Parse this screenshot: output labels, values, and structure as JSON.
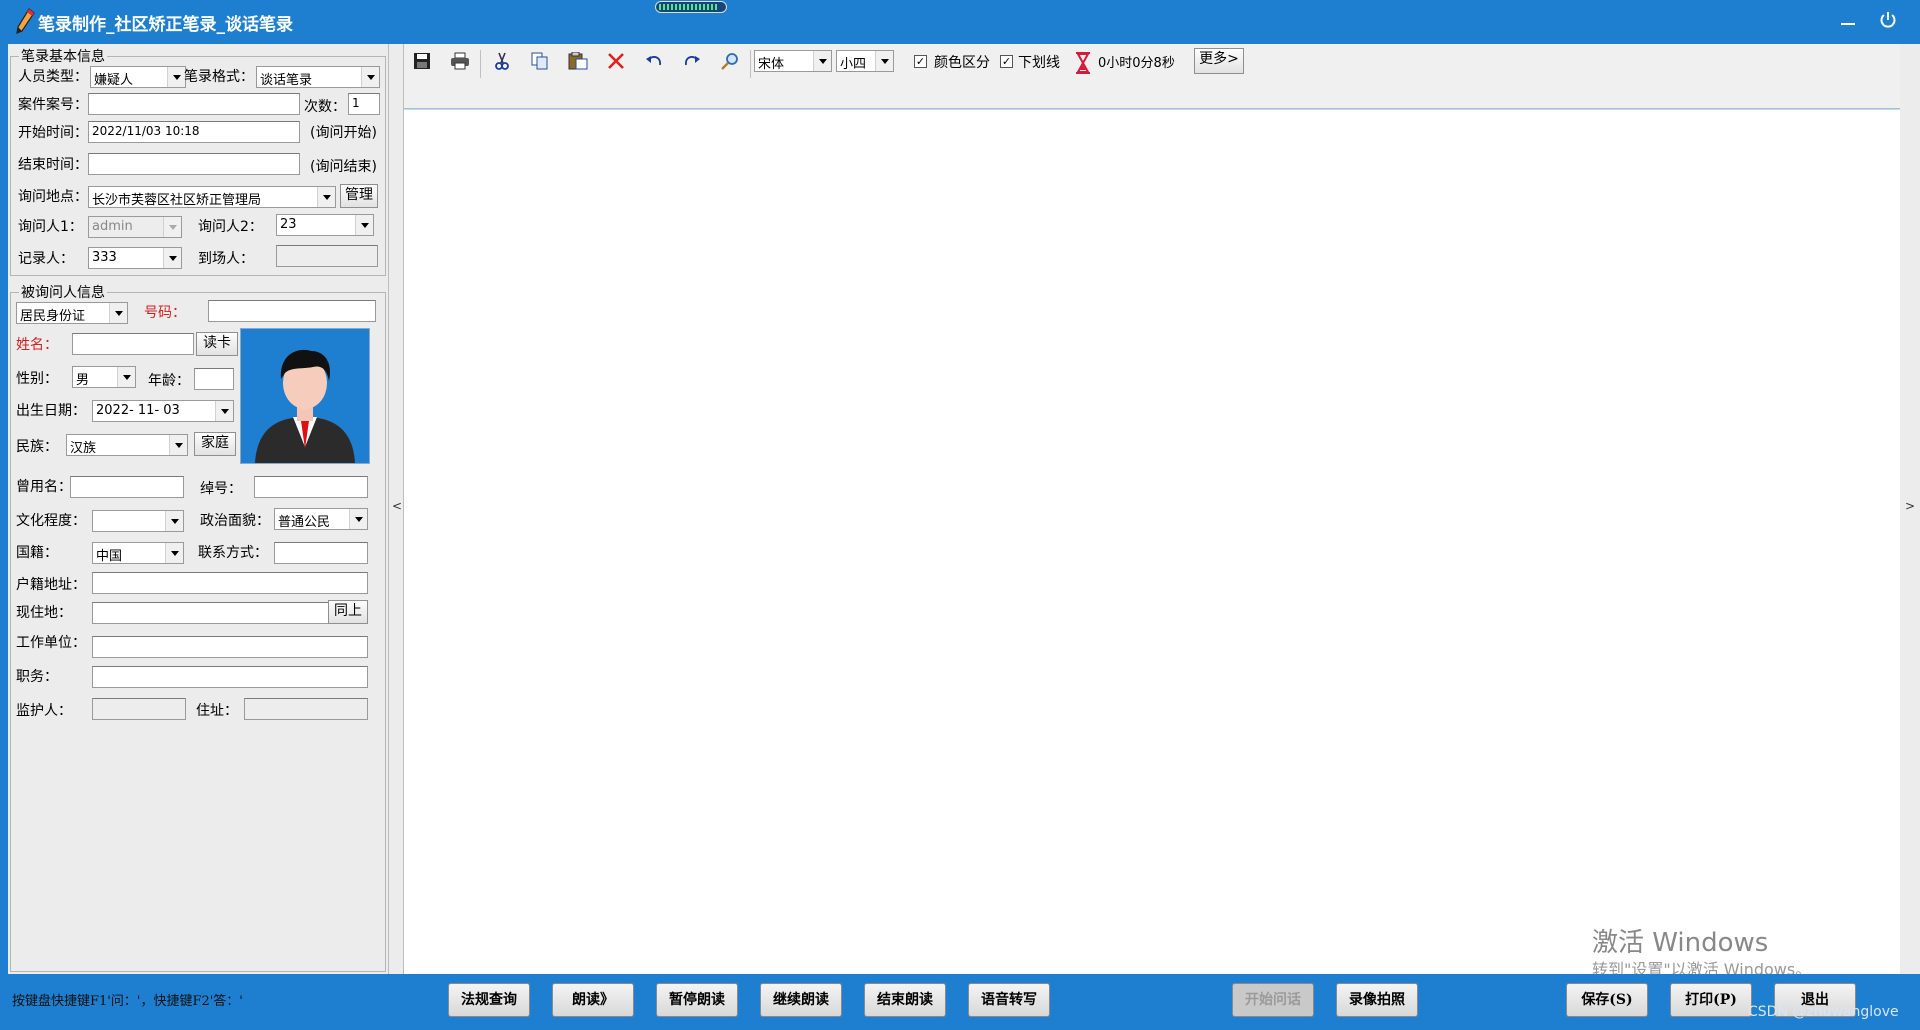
{
  "titlebar": {
    "title": "笔录制作_社区矫正笔录_谈话笔录",
    "progress_fraction": 0.9
  },
  "basic_info": {
    "legend": "笔录基本信息",
    "person_type_label": "人员类型：",
    "person_type_value": "嫌疑人",
    "format_label": "笔录格式：",
    "format_value": "谈话笔录",
    "case_no_label": "案件案号：",
    "case_no_value": "",
    "count_label": "次数：",
    "count_value": "1",
    "start_label": "开始时间：",
    "start_value": "2022/11/03 10:18",
    "start_note": "(询问开始)",
    "end_label": "结束时间：",
    "end_value": "",
    "end_note": "(询问结束)",
    "location_label": "询问地点：",
    "location_value": "长沙市芙蓉区社区矫正管理局",
    "manage_button": "管理",
    "interrogator1_label": "询问人1：",
    "interrogator1_value": "admin",
    "interrogator2_label": "询问人2：",
    "interrogator2_value": "23",
    "recorder_label": "记录人：",
    "recorder_value": "333",
    "present_label": "到场人：",
    "present_value": ""
  },
  "subject_info": {
    "legend": "被询问人信息",
    "id_type_value": "居民身份证",
    "id_number_label": "号码：",
    "id_number_value": "",
    "name_label": "姓名：",
    "name_value": "",
    "read_card_button": "读卡",
    "gender_label": "性别：",
    "gender_value": "男",
    "age_label": "年龄：",
    "age_value": "",
    "birth_label": "出生日期：",
    "birth_value": "2022-  11-  03",
    "ethnicity_label": "民族：",
    "ethnicity_value": "汉族",
    "family_button": "家庭",
    "former_name_label": "曾用名：",
    "former_name_value": "",
    "nickname_label": "绰号：",
    "nickname_value": "",
    "education_label": "文化程度：",
    "education_value": "",
    "political_label": "政治面貌：",
    "political_value": "普通公民",
    "nationality_label": "国籍：",
    "nationality_value": "中国",
    "contact_label": "联系方式：",
    "contact_value": "",
    "household_label": "户籍地址：",
    "household_value": "",
    "residence_label": "现住地：",
    "residence_value": "",
    "same_button": "同上",
    "workplace_label": "工作单位：",
    "workplace_value": "",
    "position_label": "职务：",
    "position_value": "",
    "guardian_label": "监护人：",
    "guardian_value": "",
    "address_label": "住址：",
    "address_value": ""
  },
  "toolbar": {
    "icons": [
      "save-icon",
      "print-icon",
      "cut-icon",
      "copy-icon",
      "paste-icon",
      "delete-icon",
      "undo-icon",
      "redo-icon",
      "find-icon",
      "hourglass-icon"
    ],
    "font_value": "宋体",
    "size_value": "小四",
    "color_distinguish_label": "颜色区分",
    "color_distinguish_checked": true,
    "underline_label": "下划线",
    "underline_checked": true,
    "timer_text": "0小时0分8秒",
    "more_button": "更多>"
  },
  "splitter": {
    "left_arrow": "<",
    "right_arrow": ">"
  },
  "watermark": {
    "line1": "激活 Windows",
    "line2": "转到\"设置\"以激活 Windows。"
  },
  "bottombar": {
    "hint": "按键盘快捷键F1'问：'，快捷键F2'答：'",
    "buttons": {
      "law_query": "法规查询",
      "read_aloud": "朗读》",
      "pause_reading": "暂停朗读",
      "continue_reading": "继续朗读",
      "end_reading": "结束朗读",
      "speech_to_text": "语音转写",
      "start_inquiry": "开始问话",
      "record_photo": "录像拍照",
      "save": "保存(S)",
      "print": "打印(P)",
      "exit": "退出"
    },
    "credit": "CSDN @zhuwanglove"
  },
  "colors": {
    "brand_blue": "#1e7fd0",
    "required_red": "#d21f1f",
    "panel_gray": "#ececec"
  }
}
